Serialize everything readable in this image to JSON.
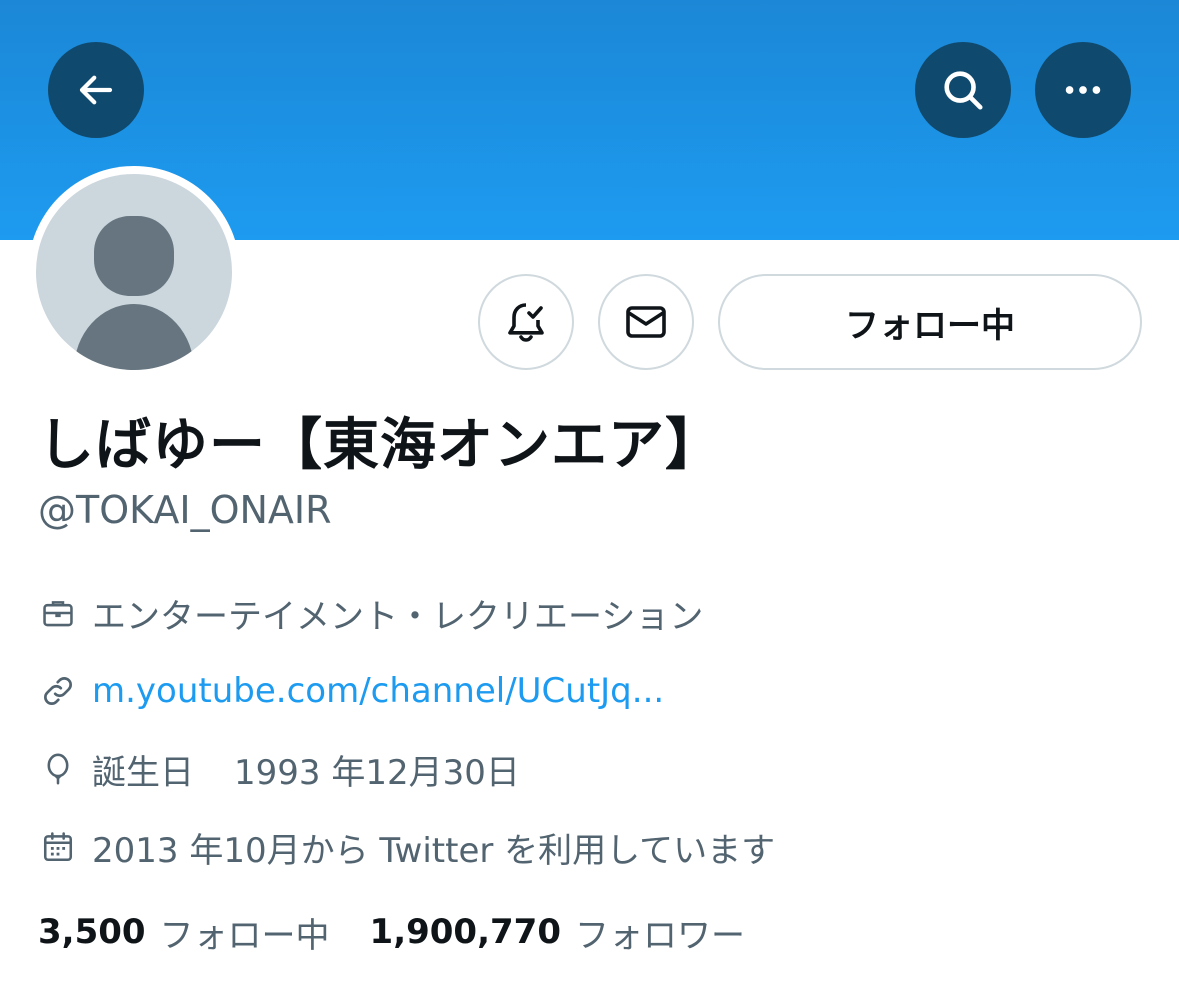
{
  "header": {
    "back_icon": "arrow-left-icon",
    "search_icon": "search-icon",
    "more_icon": "more-horizontal-icon",
    "banner_color": "#1d9bf0",
    "button_color": "#0f4a6e"
  },
  "profile": {
    "avatar_icon": "default-avatar-icon",
    "display_name": "しばゆー【東海オンエア】",
    "handle": "@TOKAI_ONAIR"
  },
  "actions": {
    "notify_icon": "bell-check-icon",
    "message_icon": "mail-icon",
    "follow_label": "フォロー中"
  },
  "meta": {
    "category": "エンターテイメント・レクリエーション",
    "link": "m.youtube.com/channel/UCutJq...",
    "birthday_label": "誕生日",
    "birthday_value": "1993 年12月30日",
    "joined": "2013 年10月から Twitter を利用しています",
    "link_color": "#1d9bf0"
  },
  "stats": {
    "following_count": "3,500",
    "following_label": "フォロー中",
    "followers_count": "1,900,770",
    "followers_label": "フォロワー"
  }
}
